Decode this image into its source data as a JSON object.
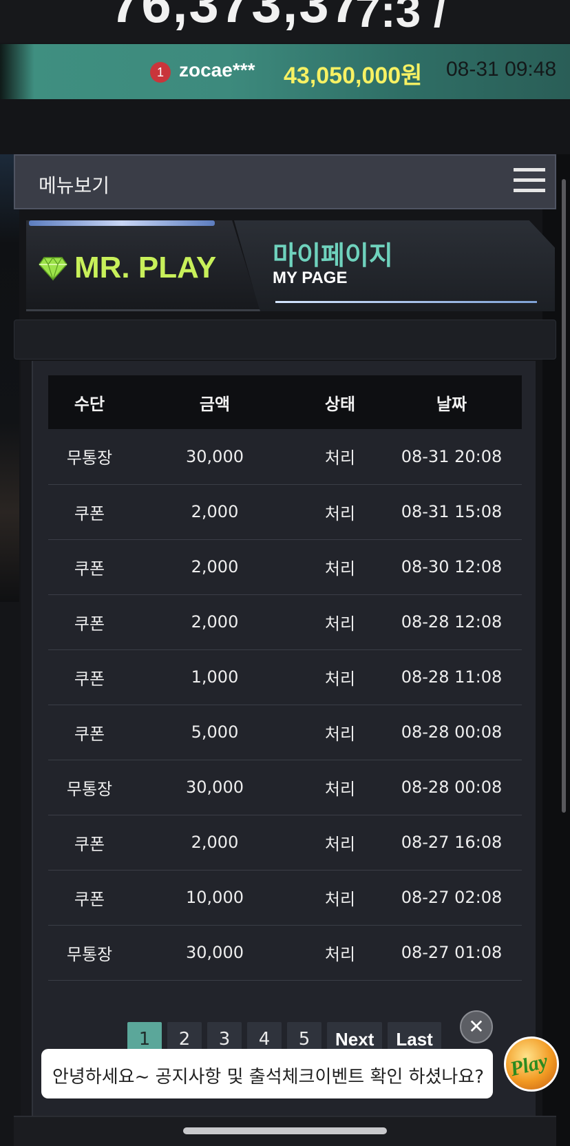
{
  "top_counter": {
    "value": "76,373,37",
    "value_tail": "7:3 /"
  },
  "winner": {
    "rank": "1",
    "user": "zocae***",
    "amount": "43,050,000원",
    "time": "08-31 09:48"
  },
  "menu": {
    "label": "메뉴보기"
  },
  "banner": {
    "brand": "MR. PLAY",
    "title_kr": "마이페이지",
    "title_en": "MY PAGE"
  },
  "table": {
    "headers": [
      "수단",
      "금액",
      "상태",
      "날짜"
    ],
    "rows": [
      [
        "무통장",
        "30,000",
        "처리",
        "08-31 20:08"
      ],
      [
        "쿠폰",
        "2,000",
        "처리",
        "08-31 15:08"
      ],
      [
        "쿠폰",
        "2,000",
        "처리",
        "08-30 12:08"
      ],
      [
        "쿠폰",
        "2,000",
        "처리",
        "08-28 12:08"
      ],
      [
        "쿠폰",
        "1,000",
        "처리",
        "08-28 11:08"
      ],
      [
        "쿠폰",
        "5,000",
        "처리",
        "08-28 00:08"
      ],
      [
        "무통장",
        "30,000",
        "처리",
        "08-28 00:08"
      ],
      [
        "쿠폰",
        "2,000",
        "처리",
        "08-27 16:08"
      ],
      [
        "쿠폰",
        "10,000",
        "처리",
        "08-27 02:08"
      ],
      [
        "무통장",
        "30,000",
        "처리",
        "08-27 01:08"
      ]
    ]
  },
  "pagination": {
    "pages": [
      "1",
      "2",
      "3",
      "4",
      "5"
    ],
    "current": "1",
    "next": "Next",
    "last": "Last"
  },
  "chat": {
    "message": "안녕하세요~ 공지사항 및 출석체크이벤트 확인 하셨나요?",
    "close": "✕",
    "avatar_text": "Play"
  },
  "colors": {
    "accent": "#5ba79a",
    "brand": "#c8f05a",
    "winner_amount": "#f7f163"
  }
}
